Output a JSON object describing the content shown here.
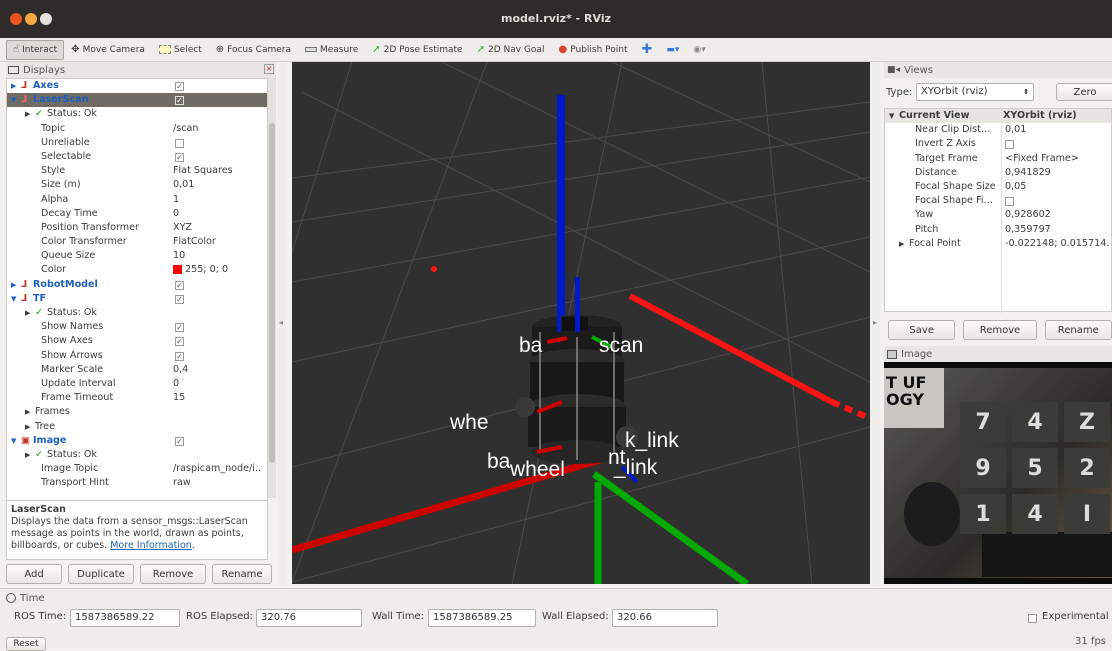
{
  "window": {
    "title": "model.rviz* - RViz"
  },
  "toolbar": {
    "interact": "Interact",
    "move_camera": "Move Camera",
    "select": "Select",
    "focus_camera": "Focus Camera",
    "measure": "Measure",
    "pose_estimate": "2D Pose Estimate",
    "nav_goal": "2D Nav Goal",
    "publish_point": "Publish Point"
  },
  "displays": {
    "title": "Displays",
    "rows": [
      {
        "label": "Axes",
        "value": "",
        "check": "on"
      },
      {
        "label": "LaserScan",
        "value": "",
        "check": "on"
      },
      {
        "label": "Status: Ok",
        "value": ""
      },
      {
        "label": "Topic",
        "value": "/scan"
      },
      {
        "label": "Unreliable",
        "value": "",
        "check": "off"
      },
      {
        "label": "Selectable",
        "value": "",
        "check": "on"
      },
      {
        "label": "Style",
        "value": "Flat Squares"
      },
      {
        "label": "Size (m)",
        "value": "0,01"
      },
      {
        "label": "Alpha",
        "value": "1"
      },
      {
        "label": "Decay Time",
        "value": "0"
      },
      {
        "label": "Position Transformer",
        "value": "XYZ"
      },
      {
        "label": "Color Transformer",
        "value": "FlatColor"
      },
      {
        "label": "Queue Size",
        "value": "10"
      },
      {
        "label": "Color",
        "value": "255; 0; 0"
      },
      {
        "label": "RobotModel",
        "value": "",
        "check": "on"
      },
      {
        "label": "TF",
        "value": "",
        "check": "on"
      },
      {
        "label": "Status: Ok",
        "value": ""
      },
      {
        "label": "Show Names",
        "value": "",
        "check": "on"
      },
      {
        "label": "Show Axes",
        "value": "",
        "check": "on"
      },
      {
        "label": "Show Arrows",
        "value": "",
        "check": "on"
      },
      {
        "label": "Marker Scale",
        "value": "0,4"
      },
      {
        "label": "Update Interval",
        "value": "0"
      },
      {
        "label": "Frame Timeout",
        "value": "15"
      },
      {
        "label": "Frames",
        "value": ""
      },
      {
        "label": "Tree",
        "value": ""
      },
      {
        "label": "Image",
        "value": "",
        "check": "on"
      },
      {
        "label": "Status: Ok",
        "value": ""
      },
      {
        "label": "Image Topic",
        "value": "/raspicam_node/i.."
      },
      {
        "label": "Transport Hint",
        "value": "raw"
      }
    ],
    "desc_title": "LaserScan",
    "desc_text": "Displays the data from a sensor_msgs::LaserScan message as points in the world, drawn as points, billboards, or cubes.",
    "desc_link": "More Information",
    "buttons": {
      "add": "Add",
      "duplicate": "Duplicate",
      "remove": "Remove",
      "rename": "Rename"
    }
  },
  "scene": {
    "labels": [
      {
        "text": "base_scan"
      },
      {
        "text": "wheel_left"
      },
      {
        "text": "back_link"
      },
      {
        "text": "base_footprint"
      },
      {
        "text": "wheel_right"
      },
      {
        "text": "imu_link"
      }
    ],
    "visible_labels": [
      "ba",
      "scan",
      "whe",
      "k_link",
      "ba",
      "wheel",
      "_link",
      "nt"
    ]
  },
  "views": {
    "title": "Views",
    "type_label": "Type:",
    "type_value": "XYOrbit (rviz)",
    "zero": "Zero",
    "current": "Current View",
    "current_value": "XYOrbit (rviz)",
    "props": [
      {
        "label": "Near Clip Dist…",
        "value": "0,01"
      },
      {
        "label": "Invert Z Axis",
        "value": "",
        "check": "off"
      },
      {
        "label": "Target Frame",
        "value": "<Fixed Frame>"
      },
      {
        "label": "Distance",
        "value": "0,941829"
      },
      {
        "label": "Focal Shape Size",
        "value": "0,05"
      },
      {
        "label": "Focal Shape Fi…",
        "value": "",
        "check": "off"
      },
      {
        "label": "Yaw",
        "value": "0,928602"
      },
      {
        "label": "Pitch",
        "value": "0,359797"
      },
      {
        "label": "Focal Point",
        "value": "-0.022148; 0.015714."
      }
    ],
    "buttons": {
      "save": "Save",
      "remove": "Remove",
      "rename": "Rename"
    }
  },
  "image_panel": {
    "title": "Image",
    "visible_text": [
      "T UF",
      "OGY",
      "7",
      "4",
      "Z",
      "9",
      "5",
      "2",
      "1",
      "4",
      "I"
    ]
  },
  "time": {
    "title": "Time",
    "ros_time_label": "ROS Time:",
    "ros_time": "1587386589.22",
    "ros_elapsed_label": "ROS Elapsed:",
    "ros_elapsed": "320.76",
    "wall_time_label": "Wall Time:",
    "wall_time": "1587386589.25",
    "wall_elapsed_label": "Wall Elapsed:",
    "wall_elapsed": "320.66",
    "experimental": "Experimental",
    "reset": "Reset",
    "fps": "31 fps"
  },
  "colors": {
    "title_bg": "#2d2c2a",
    "selected_row": "#6f6c68",
    "link": "#1d5fbf",
    "viewport": "#303030",
    "laser": "#ff0000"
  }
}
